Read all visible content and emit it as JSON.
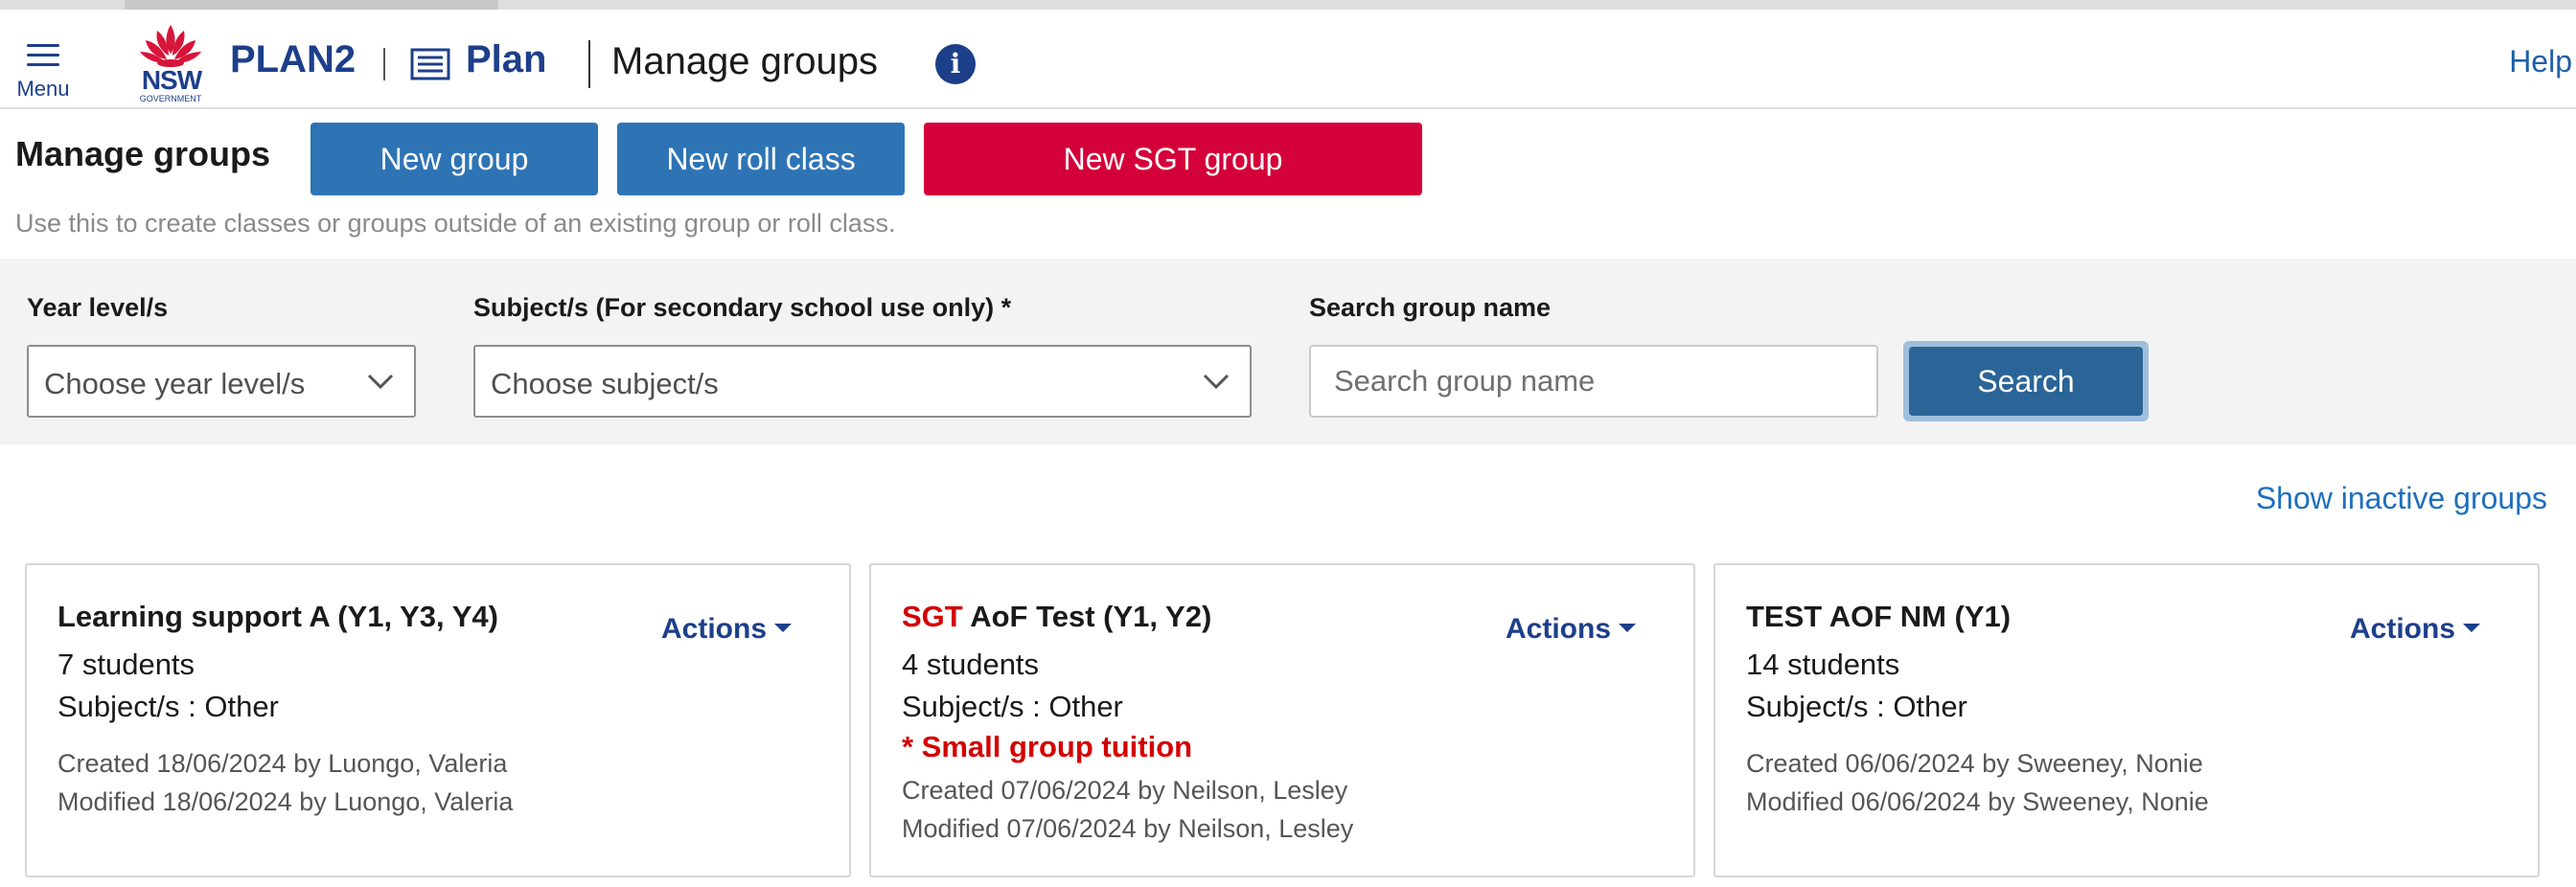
{
  "header": {
    "menu_label": "Menu",
    "logo_text": "NSW",
    "logo_subtext": "GOVERNMENT",
    "app_name": "PLAN2",
    "section_label": "Plan",
    "page_name": "Manage groups",
    "info_glyph": "i",
    "help_label": "Help"
  },
  "toolbar": {
    "title": "Manage groups",
    "new_group_label": "New group",
    "new_roll_class_label": "New roll class",
    "new_sgt_group_label": "New SGT group",
    "description": "Use this to create classes or groups outside of an existing group or roll class."
  },
  "filters": {
    "year_label": "Year level/s",
    "year_value": "Choose year level/s",
    "subject_label": "Subject/s (For secondary school use only) *",
    "subject_value": "Choose subject/s",
    "search_label": "Search group name",
    "search_placeholder": "Search group name",
    "search_button": "Search"
  },
  "show_inactive_label": "Show inactive groups",
  "cards": [
    {
      "sgt_tag": "",
      "name": "Learning support A (Y1, Y3, Y4)",
      "students": "7 students",
      "subjects": "Subject/s : Other",
      "tuition": "",
      "created": "Created 18/06/2024 by Luongo, Valeria",
      "modified": "Modified 18/06/2024 by Luongo, Valeria",
      "actions_label": "Actions"
    },
    {
      "sgt_tag": "SGT",
      "name": "AoF Test (Y1, Y2)",
      "students": "4 students",
      "subjects": "Subject/s : Other",
      "tuition": "* Small group tuition",
      "created": "Created 07/06/2024 by Neilson, Lesley",
      "modified": "Modified 07/06/2024 by Neilson, Lesley",
      "actions_label": "Actions"
    },
    {
      "sgt_tag": "",
      "name": "TEST AOF NM (Y1)",
      "students": "14 students",
      "subjects": "Subject/s : Other",
      "tuition": "",
      "created": "Created 06/06/2024 by Sweeney, Nonie",
      "modified": "Modified 06/06/2024 by Sweeney, Nonie",
      "actions_label": "Actions"
    }
  ],
  "colors": {
    "brand_navy": "#1d3f8a",
    "button_blue": "#2e74b5",
    "sgt_red": "#d4003a",
    "search_button": "#2b6496",
    "link_blue": "#1d6fbd"
  }
}
